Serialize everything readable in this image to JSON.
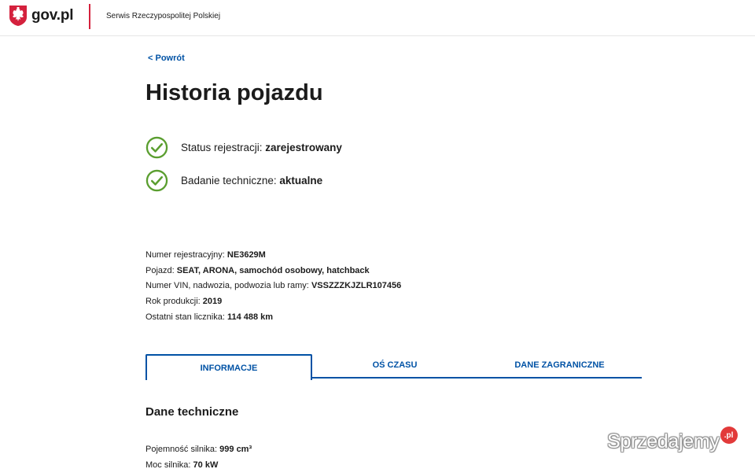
{
  "header": {
    "logo_text": "gov.pl",
    "service_name": "Serwis Rzeczypospolitej Polskiej",
    "accent_color": "#d4213d"
  },
  "nav": {
    "back_label": "< Powrót"
  },
  "page": {
    "title": "Historia pojazdu"
  },
  "statuses": [
    {
      "label": "Status rejestracji: ",
      "value": "zarejestrowany",
      "icon": "check-circle-icon",
      "color": "#5a9e2f"
    },
    {
      "label": "Badanie techniczne: ",
      "value": "aktualne",
      "icon": "check-circle-icon",
      "color": "#5a9e2f"
    }
  ],
  "vehicle": {
    "registration_label": "Numer rejestracyjny: ",
    "registration_value": "NE3629M",
    "vehicle_label": "Pojazd: ",
    "vehicle_value": "SEAT, ARONA, samochód osobowy, hatchback",
    "vin_label": "Numer VIN, nadwozia, podwozia lub ramy: ",
    "vin_value": "VSSZZZKJZLR107456",
    "year_label": "Rok produkcji: ",
    "year_value": "2019",
    "odometer_label": "Ostatni stan licznika: ",
    "odometer_value": "114 488 km"
  },
  "tabs": [
    {
      "label": "INFORMACJE",
      "active": true
    },
    {
      "label": "OŚ CZASU",
      "active": false
    },
    {
      "label": "DANE ZAGRANICZNE",
      "active": false
    }
  ],
  "technical": {
    "section_title": "Dane techniczne",
    "engine_capacity_label": "Pojemność silnika: ",
    "engine_capacity_value": "999 cm³",
    "engine_power_label": "Moc silnika: ",
    "engine_power_value": "70 kW"
  },
  "watermark": {
    "text": "Sprzedajemy",
    "badge": ".pl"
  },
  "colors": {
    "link": "#0052a5",
    "check": "#5a9e2f",
    "watermark_badge": "#e23a3a"
  }
}
